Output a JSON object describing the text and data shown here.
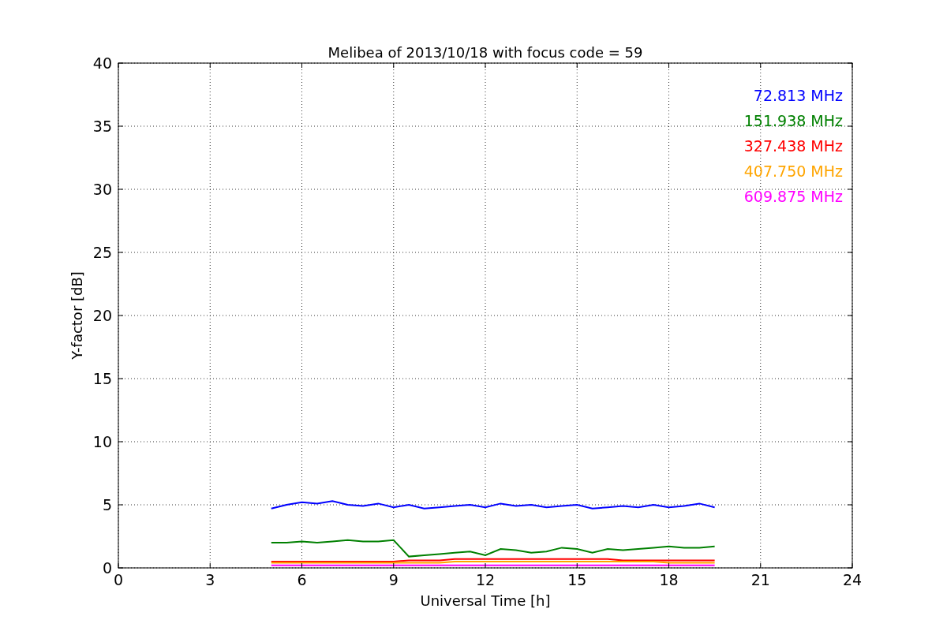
{
  "figure": {
    "chart_data": {
      "type": "line",
      "grid": true,
      "title": "Melibea of 2013/10/18 with focus code = 59",
      "xlabel": "Universal Time [h]",
      "ylabel": "Y-factor [dB]",
      "xlim": [
        0,
        24
      ],
      "ylim": [
        0,
        40
      ],
      "xticks": [
        0,
        3,
        6,
        9,
        12,
        15,
        18,
        21,
        24
      ],
      "yticks": [
        0,
        5,
        10,
        15,
        20,
        25,
        30,
        35,
        40
      ],
      "x": [
        5,
        5.5,
        6,
        6.5,
        7,
        7.5,
        8,
        8.5,
        9,
        9.5,
        10,
        10.5,
        11,
        11.5,
        12,
        12.5,
        13,
        13.5,
        14,
        14.5,
        15,
        15.5,
        16,
        16.5,
        17,
        17.5,
        18,
        18.5,
        19,
        19.5
      ],
      "series": [
        {
          "name": "72.813 MHz",
          "color": "#0000ff",
          "values": [
            4.7,
            5.0,
            5.2,
            5.1,
            5.3,
            5.0,
            4.9,
            5.1,
            4.8,
            5.0,
            4.7,
            4.8,
            4.9,
            5.0,
            4.8,
            5.1,
            4.9,
            5.0,
            4.8,
            4.9,
            5.0,
            4.7,
            4.8,
            4.9,
            4.8,
            5.0,
            4.8,
            4.9,
            5.1,
            4.8
          ]
        },
        {
          "name": "151.938 MHz",
          "color": "#008000",
          "values": [
            2.0,
            2.0,
            2.1,
            2.0,
            2.1,
            2.2,
            2.1,
            2.1,
            2.2,
            0.9,
            1.0,
            1.1,
            1.2,
            1.3,
            1.0,
            1.5,
            1.4,
            1.2,
            1.3,
            1.6,
            1.5,
            1.2,
            1.5,
            1.4,
            1.5,
            1.6,
            1.7,
            1.6,
            1.6,
            1.7
          ]
        },
        {
          "name": "327.438 MHz",
          "color": "#ff0000",
          "values": [
            0.5,
            0.5,
            0.5,
            0.5,
            0.5,
            0.5,
            0.5,
            0.5,
            0.5,
            0.6,
            0.6,
            0.6,
            0.7,
            0.7,
            0.7,
            0.7,
            0.7,
            0.7,
            0.7,
            0.7,
            0.7,
            0.7,
            0.7,
            0.6,
            0.6,
            0.6,
            0.6,
            0.6,
            0.6,
            0.6
          ]
        },
        {
          "name": "407.750 MHz",
          "color": "#ffa500",
          "values": [
            0.4,
            0.4,
            0.4,
            0.4,
            0.4,
            0.4,
            0.4,
            0.4,
            0.4,
            0.4,
            0.4,
            0.4,
            0.5,
            0.5,
            0.5,
            0.5,
            0.5,
            0.5,
            0.5,
            0.5,
            0.5,
            0.5,
            0.5,
            0.5,
            0.5,
            0.5,
            0.4,
            0.4,
            0.4,
            0.4
          ]
        },
        {
          "name": "609.875 MHz",
          "color": "#ff00ff",
          "values": [
            0.2,
            0.2,
            0.2,
            0.2,
            0.2,
            0.2,
            0.2,
            0.2,
            0.2,
            0.2,
            0.2,
            0.2,
            0.2,
            0.2,
            0.2,
            0.2,
            0.2,
            0.2,
            0.2,
            0.2,
            0.2,
            0.2,
            0.2,
            0.2,
            0.2,
            0.2,
            0.2,
            0.2,
            0.2,
            0.2
          ]
        }
      ]
    }
  }
}
